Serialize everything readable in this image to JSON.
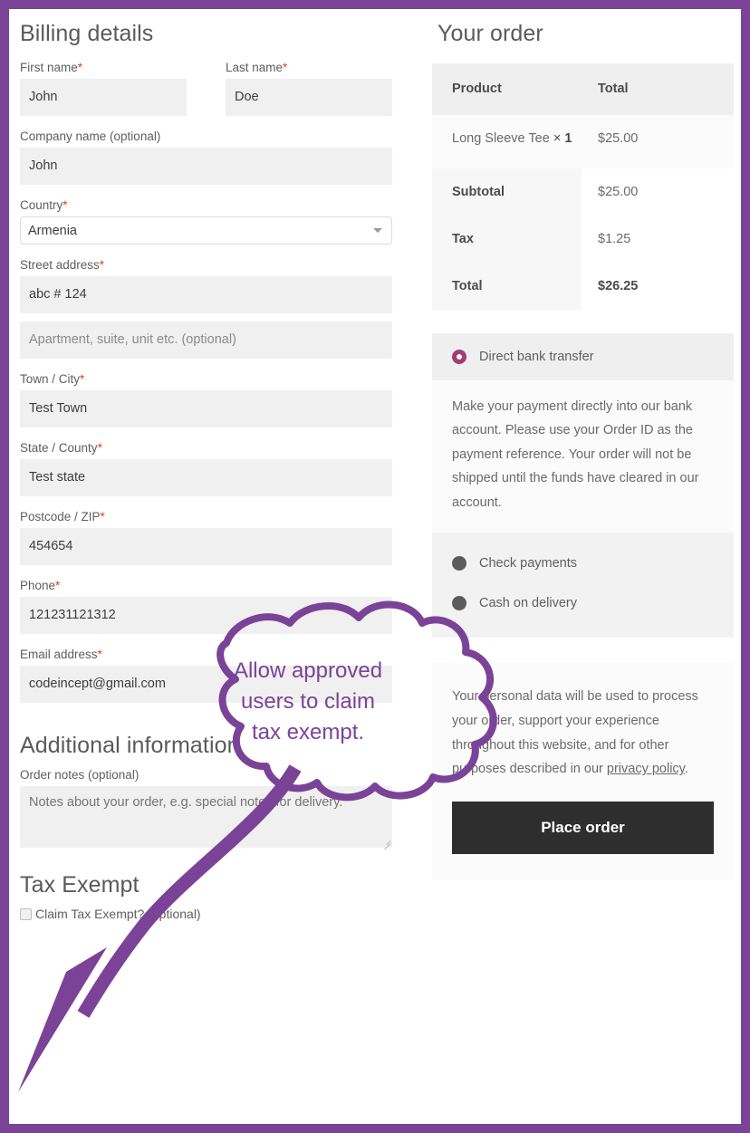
{
  "theme": {
    "page_border_color": "#7b4397",
    "annotation_color": "#7b4397",
    "accent_radio_color": "#a33b78",
    "required_mark_color": "#e2401c",
    "button_color": "#2e2e2e"
  },
  "billing": {
    "title": "Billing details",
    "required_mark": "*",
    "fields": {
      "first_name": {
        "label": "First name",
        "required": true,
        "value": "John"
      },
      "last_name": {
        "label": "Last name",
        "required": true,
        "value": "Doe"
      },
      "company": {
        "label": "Company name (optional)",
        "required": false,
        "value": "John"
      },
      "country": {
        "label": "Country",
        "required": true,
        "value": "Armenia",
        "options": [
          "Armenia"
        ]
      },
      "street_address": {
        "label": "Street address",
        "required": true,
        "value": "abc # 124"
      },
      "address_2": {
        "label": "",
        "required": false,
        "value": "",
        "placeholder": "Apartment, suite, unit etc. (optional)"
      },
      "town_city": {
        "label": "Town / City",
        "required": true,
        "value": "Test Town"
      },
      "state_county": {
        "label": "State / County",
        "required": true,
        "value": "Test state"
      },
      "postcode": {
        "label": "Postcode / ZIP",
        "required": true,
        "value": "454654"
      },
      "phone": {
        "label": "Phone",
        "required": true,
        "value": "121231121312"
      },
      "email": {
        "label": "Email address",
        "required": true,
        "value": "codeincept@gmail.com"
      }
    }
  },
  "additional": {
    "title": "Additional information",
    "order_notes": {
      "label": "Order notes (optional)",
      "value": "",
      "placeholder": "Notes about your order, e.g. special notes for delivery."
    }
  },
  "tax_exempt": {
    "title": "Tax Exempt",
    "checkbox_label": "Claim Tax Exempt? (optional)",
    "checked": false
  },
  "order": {
    "title": "Your order",
    "columns": [
      "Product",
      "Total"
    ],
    "items": [
      {
        "name": "Long Sleeve Tee",
        "quantity_separator": "×",
        "quantity": "1",
        "total": "$25.00"
      }
    ],
    "summary": [
      {
        "label": "Subtotal",
        "value": "$25.00",
        "emphasis": false
      },
      {
        "label": "Tax",
        "value": "$1.25",
        "emphasis": false
      },
      {
        "label": "Total",
        "value": "$26.25",
        "emphasis": true
      }
    ]
  },
  "payment": {
    "selected": "Direct bank transfer",
    "selected_description": "Make your payment directly into our bank account. Please use your Order ID as the payment reference. Your order will not be shipped until the funds have cleared in our account.",
    "other_methods": [
      "Check payments",
      "Cash on delivery"
    ]
  },
  "privacy": {
    "text_before_link": "Your personal data will be used to process your order, support your experience throughout this website, and for other purposes described in our ",
    "link_text": "privacy policy",
    "text_after_link": ".",
    "place_order_label": "Place order"
  },
  "annotation": {
    "bubble_text": "Allow approved users to claim tax exempt.",
    "bubble_line_1": "Allow approved",
    "bubble_line_2": "users to claim",
    "bubble_line_3": "tax exempt."
  }
}
